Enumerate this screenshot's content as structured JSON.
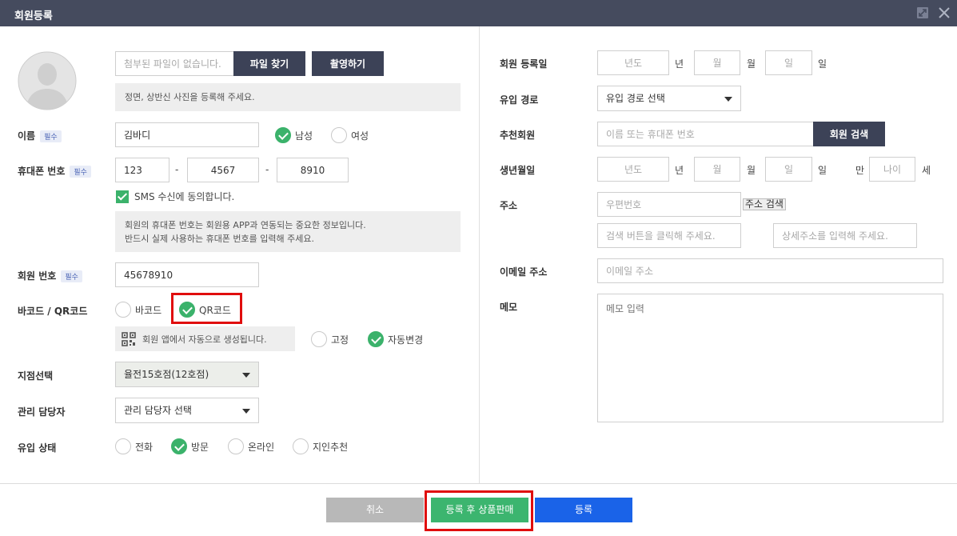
{
  "window": {
    "title": "회원등록"
  },
  "photo": {
    "file_placeholder": "첨부된 파일이 없습니다.",
    "find_button": "파일 찾기",
    "capture_button": "촬영하기",
    "note": "정면, 상반신 사진을 등록해 주세요."
  },
  "name": {
    "label": "이름",
    "required": "필수",
    "value": "김바디",
    "gender_male": "남성",
    "gender_female": "여성",
    "selected": "남성"
  },
  "phone": {
    "label": "휴대폰 번호",
    "required": "필수",
    "part1": "123",
    "part2": "4567",
    "part3": "8910",
    "separator": "-",
    "sms_label": "SMS 수신에 동의합니다.",
    "note_line1": "회원의 휴대폰 번호는 회원용 APP과 연동되는 중요한 정보입니다.",
    "note_line2": "반드시 실제 사용하는 휴대폰 번호를 입력해 주세요."
  },
  "member_number": {
    "label": "회원 번호",
    "required": "필수",
    "value": "45678910"
  },
  "barcode": {
    "label": "바코드 / QR코드",
    "option_barcode": "바코드",
    "option_qr": "QR코드",
    "selected": "QR코드",
    "note": "회원 앱에서 자동으로 생성됩니다.",
    "option_fixed": "고정",
    "option_auto": "자동변경",
    "mode_selected": "자동변경"
  },
  "branch": {
    "label": "지점선택",
    "value": "율전15호점(12호점)"
  },
  "manager": {
    "label": "관리 담당자",
    "value": "관리 담당자 선택"
  },
  "inflow_status": {
    "label": "유입 상태",
    "options": [
      "전화",
      "방문",
      "온라인",
      "지인추천"
    ],
    "selected": "방문"
  },
  "right": {
    "reg_date": {
      "label": "회원 등록일",
      "year_ph": "년도",
      "year_unit": "년",
      "month_ph": "월",
      "month_unit": "월",
      "day_ph": "일",
      "day_unit": "일"
    },
    "inflow_path": {
      "label": "유입 경로",
      "value": "유입 경로 선택"
    },
    "referrer": {
      "label": "추천회원",
      "placeholder": "이름 또는 휴대폰 번호",
      "button": "회원 검색"
    },
    "birth": {
      "label": "생년월일",
      "year_ph": "년도",
      "year_unit": "년",
      "month_ph": "월",
      "month_unit": "월",
      "day_ph": "일",
      "day_unit": "일",
      "age_prefix": "만",
      "age_ph": "나이",
      "age_unit": "세"
    },
    "address": {
      "label": "주소",
      "zip_ph": "우편번호",
      "search_button": "주소 검색",
      "addr1_ph": "검색 버튼을 클릭해 주세요.",
      "addr2_ph": "상세주소를 입력해 주세요."
    },
    "email": {
      "label": "이메일 주소",
      "placeholder": "이메일 주소"
    },
    "memo": {
      "label": "메모",
      "placeholder": "메모 입력"
    }
  },
  "footer": {
    "cancel": "취소",
    "register_and_sell": "등록 후 상품판매",
    "register": "등록"
  },
  "colors": {
    "titlebar": "#454b5e",
    "dark_button": "#3c4257",
    "check_green": "#3bb26b",
    "register_blue": "#1a63e8",
    "sell_green": "#3cb56f",
    "cancel_gray": "#b8b8b8",
    "highlight_red": "#e00d0d"
  }
}
